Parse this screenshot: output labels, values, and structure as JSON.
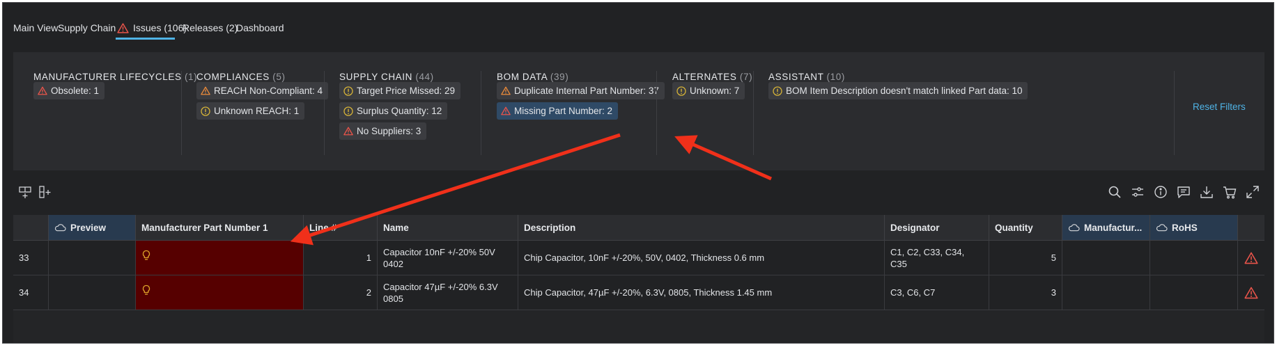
{
  "tabs": [
    {
      "label": "Main View"
    },
    {
      "label": "Supply Chain"
    },
    {
      "label": "Issues (106)",
      "active": true
    },
    {
      "label": "Releases (2)"
    },
    {
      "label": "Dashboard"
    }
  ],
  "filters": {
    "groups": [
      {
        "title": "MANUFACTURER LIFECYCLES",
        "count": "(1)",
        "chips": [
          {
            "label": "Obsolete: 1",
            "icon": "warning-triangle-red"
          }
        ]
      },
      {
        "title": "COMPLIANCES",
        "count": "(5)",
        "chips": [
          {
            "label": "REACH Non-Compliant: 4",
            "icon": "warning-triangle-orange"
          },
          {
            "label": "Unknown REACH: 1",
            "icon": "exclamation-circle-yellow"
          }
        ]
      },
      {
        "title": "SUPPLY CHAIN",
        "count": "(44)",
        "chips": [
          {
            "label": "Target Price Missed: 29",
            "icon": "exclamation-circle-yellow"
          },
          {
            "label": "Surplus Quantity: 12",
            "icon": "exclamation-circle-yellow"
          },
          {
            "label": "No Suppliers: 3",
            "icon": "warning-triangle-red"
          }
        ]
      },
      {
        "title": "BOM DATA",
        "count": "(39)",
        "chips": [
          {
            "label": "Duplicate Internal Part Number: 37",
            "icon": "warning-triangle-orange"
          },
          {
            "label": "Missing Part Number: 2",
            "icon": "warning-triangle-red",
            "selected": true
          }
        ]
      },
      {
        "title": "ALTERNATES",
        "count": "(7)",
        "chips": [
          {
            "label": "Unknown: 7",
            "icon": "exclamation-circle-yellow"
          }
        ]
      },
      {
        "title": "ASSISTANT",
        "count": "(10)",
        "chips": [
          {
            "label": "BOM Item Description doesn't match linked Part data: 10",
            "icon": "exclamation-circle-yellow"
          }
        ]
      }
    ],
    "reset_label": "Reset Filters"
  },
  "toolbar": {
    "left_icons": [
      "add-row-icon",
      "add-column-icon"
    ],
    "right_icons": [
      "search-icon",
      "filter-sliders-icon",
      "info-icon",
      "comment-icon",
      "download-icon",
      "cart-icon",
      "expand-icon"
    ]
  },
  "table": {
    "columns": [
      "",
      "Preview",
      "Manufacturer Part Number 1",
      "Line #",
      "Name",
      "Description",
      "Designator",
      "Quantity",
      "Manufactur...",
      "RoHS",
      ""
    ],
    "rows": [
      {
        "index": "33",
        "preview": "",
        "mpn": "",
        "line": "1",
        "name": "Capacitor 10nF +/-20% 50V 0402",
        "description": "Chip Capacitor, 10nF +/-20%, 50V, 0402, Thickness 0.6 mm",
        "designator": "C1, C2, C33, C34, C35",
        "quantity": "5",
        "manufacturer": "",
        "rohs": ""
      },
      {
        "index": "34",
        "preview": "",
        "mpn": "",
        "line": "2",
        "name": "Capacitor 47µF +/-20% 6.3V 0805",
        "description": "Chip Capacitor, 47µF +/-20%, 6.3V, 0805, Thickness 1.45 mm",
        "designator": "C3, C6, C7",
        "quantity": "3",
        "manufacturer": "",
        "rohs": ""
      }
    ]
  },
  "colors": {
    "accent": "#4fb3e6",
    "warning_red": "#e8544a",
    "warning_orange": "#e8893a",
    "warning_yellow": "#d7b437",
    "missing_cell": "#560000",
    "annotation_arrow": "#f0301a"
  }
}
